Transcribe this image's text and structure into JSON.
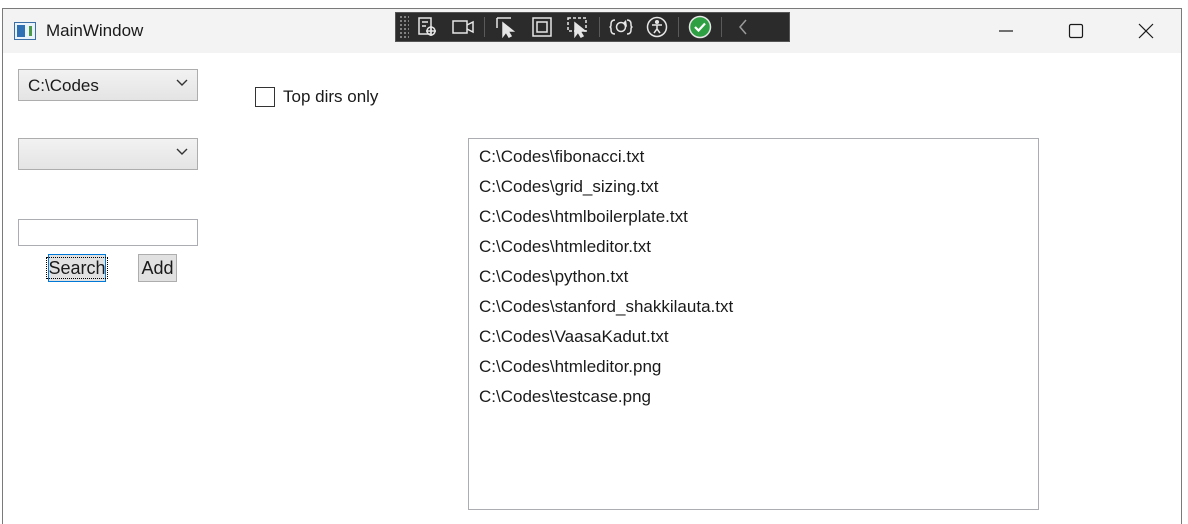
{
  "window": {
    "title": "MainWindow"
  },
  "title_bar": {
    "minimize_icon": "minimize-icon",
    "maximize_icon": "maximize-icon",
    "close_icon": "close-icon"
  },
  "debug_toolbar": {
    "icons": [
      "live-visual-tree-icon",
      "video-icon",
      "select-element-icon",
      "display-layout-adorners-icon",
      "track-focus-icon",
      "hot-reload-icon",
      "accessibility-icon",
      "checkmark-icon",
      "collapse-chevron-icon"
    ]
  },
  "path_combo": {
    "selected": "C:\\Codes"
  },
  "second_combo": {
    "selected": ""
  },
  "search_field": {
    "value": ""
  },
  "buttons": {
    "search": "Search",
    "add": "Add"
  },
  "top_dirs": {
    "label": "Top dirs only",
    "checked": false
  },
  "files": [
    "C:\\Codes\\fibonacci.txt",
    "C:\\Codes\\grid_sizing.txt",
    "C:\\Codes\\htmlboilerplate.txt",
    "C:\\Codes\\htmleditor.txt",
    "C:\\Codes\\python.txt",
    "C:\\Codes\\stanford_shakkilauta.txt",
    "C:\\Codes\\VaasaKadut.txt",
    "C:\\Codes\\htmleditor.png",
    "C:\\Codes\\testcase.png"
  ],
  "colors": {
    "titlebar": "#f3f3f3",
    "accent": "#0078d7",
    "toolbar": "#2b2b2b",
    "check_green": "#2ea043"
  }
}
